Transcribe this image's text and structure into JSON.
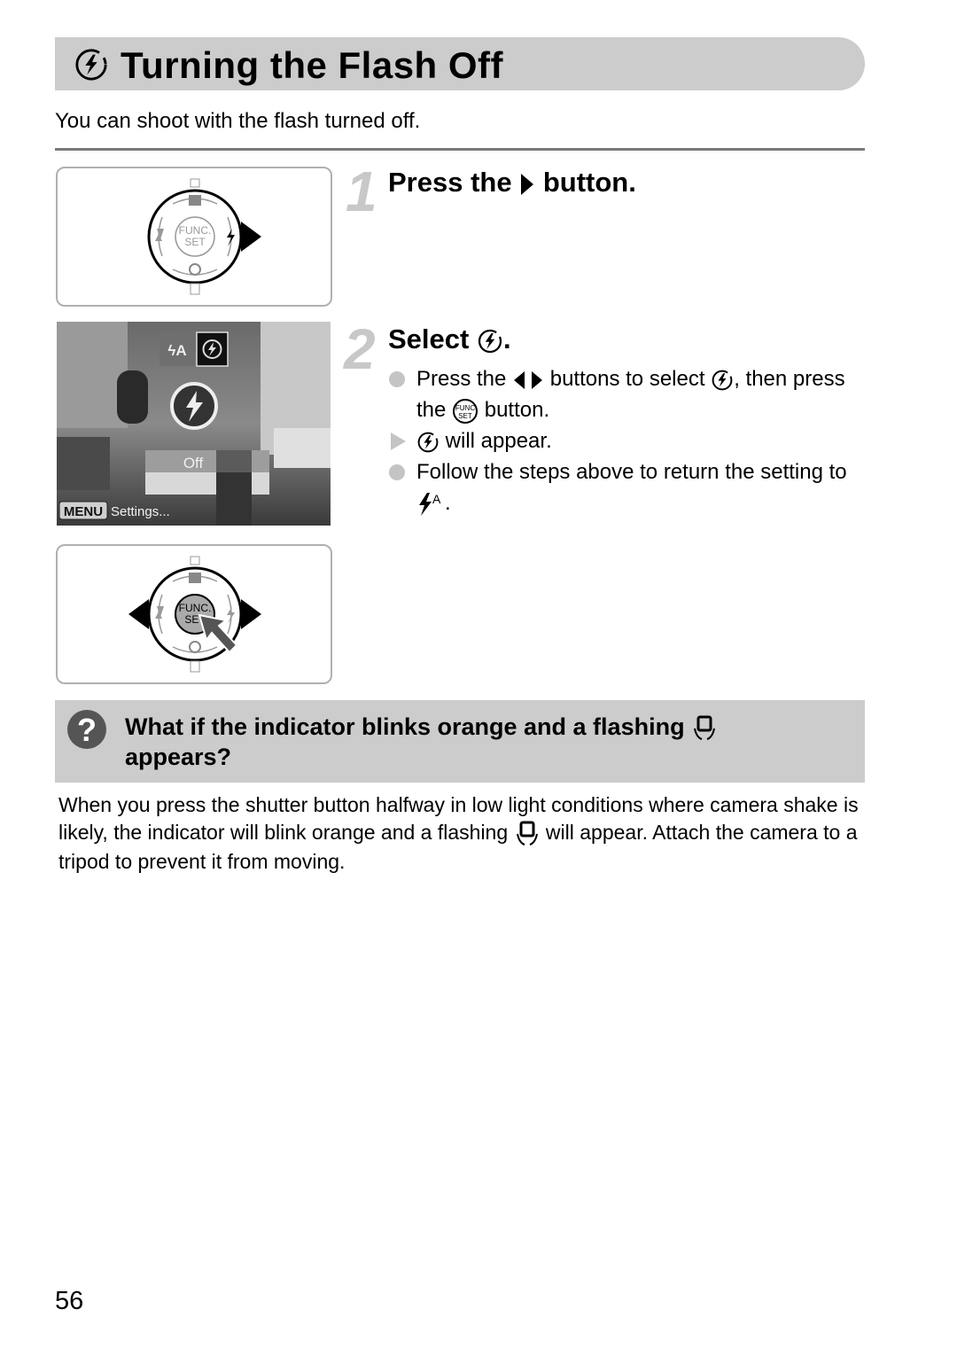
{
  "page": {
    "title": "Turning the Flash Off",
    "title_icon": "flash-off-icon",
    "intro": "You can shoot with the flash turned off.",
    "page_number": "56"
  },
  "steps": [
    {
      "number": "1",
      "title_before": "Press the",
      "title_icon": "right-arrow-icon",
      "title_after": "button."
    },
    {
      "number": "2",
      "title_before": "Select",
      "title_icon": "flash-off-icon",
      "title_after": ".",
      "items": [
        {
          "type": "bullet",
          "parts": [
            "Press the",
            "buttons to select",
            ", then press the",
            "button."
          ],
          "icons": [
            "left-right-arrows-icon",
            "flash-off-icon",
            "func-set-icon"
          ]
        },
        {
          "type": "result",
          "parts": [
            "will appear."
          ],
          "icons": [
            "flash-off-icon"
          ]
        },
        {
          "type": "bullet",
          "parts": [
            "Follow the steps above to return the setting to",
            "."
          ],
          "icons": [
            "flash-auto-icon"
          ]
        }
      ]
    }
  ],
  "illustrations": {
    "dial_labels": {
      "func": "FUNC.",
      "set": "SET"
    },
    "screen": {
      "flash_auto_label": "ϟA",
      "off_label": "Off",
      "menu_label": "MENU",
      "settings_label": "Settings..."
    }
  },
  "faq": {
    "icon": "question-icon",
    "title_before": "What if the indicator blinks orange and a flashing",
    "title_icon": "camera-shake-icon",
    "title_after": "appears?",
    "body_before": "When you press the shutter button halfway in low light conditions where camera shake is likely, the indicator will blink orange and a flashing",
    "body_icon": "camera-shake-icon",
    "body_after": "will appear. Attach the camera to a tripod to prevent it from moving."
  }
}
